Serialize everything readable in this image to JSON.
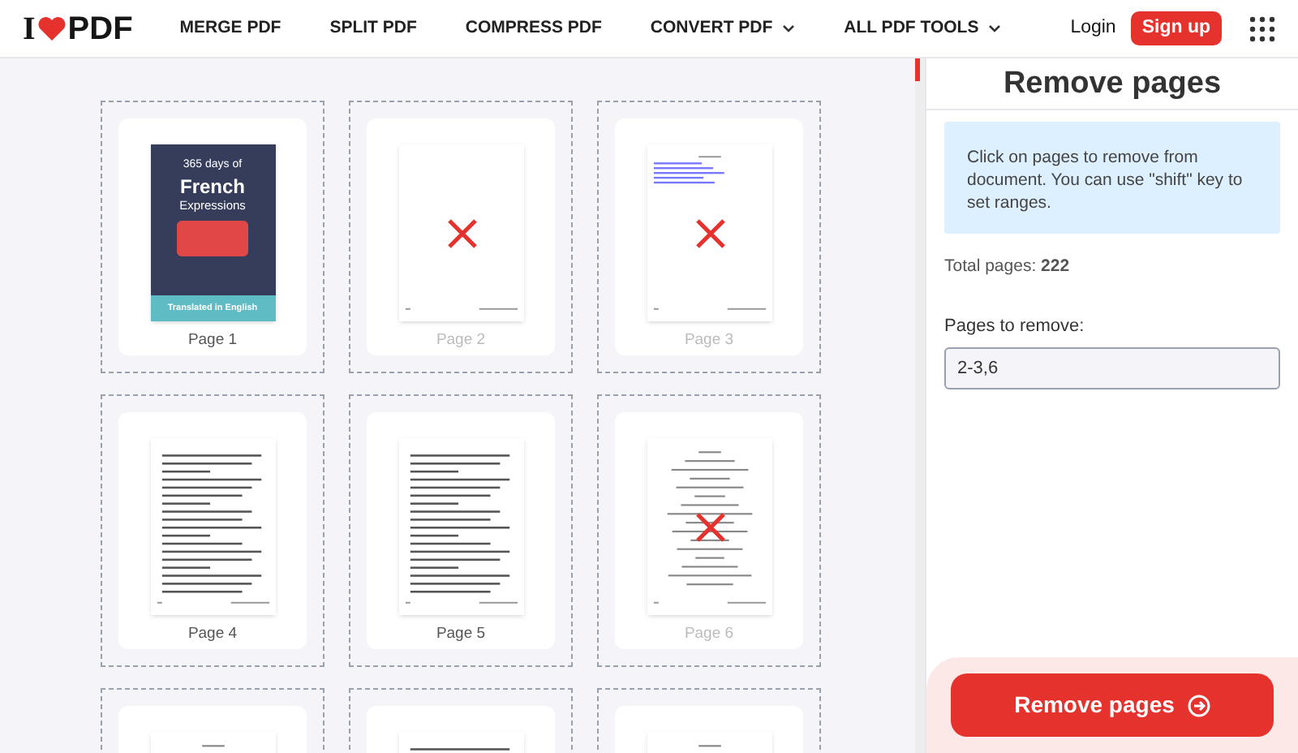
{
  "header": {
    "logo": {
      "left": "I",
      "right": "PDF"
    },
    "nav": [
      {
        "label": "MERGE PDF",
        "dropdown": false
      },
      {
        "label": "SPLIT PDF",
        "dropdown": false
      },
      {
        "label": "COMPRESS PDF",
        "dropdown": false
      },
      {
        "label": "CONVERT PDF",
        "dropdown": true
      },
      {
        "label": "ALL PDF TOOLS",
        "dropdown": true
      }
    ],
    "login": "Login",
    "signup": "Sign up"
  },
  "pages": [
    {
      "label": "Page 1",
      "removed": false,
      "kind": "cover",
      "cover": {
        "line1": "365 days of",
        "line2": "French",
        "line3": "Expressions",
        "band": "Translated in English"
      }
    },
    {
      "label": "Page 2",
      "removed": true,
      "kind": "blank"
    },
    {
      "label": "Page 3",
      "removed": true,
      "kind": "links"
    },
    {
      "label": "Page 4",
      "removed": false,
      "kind": "text"
    },
    {
      "label": "Page 5",
      "removed": false,
      "kind": "text"
    },
    {
      "label": "Page 6",
      "removed": true,
      "kind": "centered"
    },
    {
      "kind": "centered"
    },
    {
      "kind": "text"
    },
    {
      "kind": "centered"
    }
  ],
  "panel": {
    "title": "Remove pages",
    "info": "Click on pages to remove from document. You can use \"shift\" key to set ranges.",
    "total_label": "Total pages:",
    "total": "222",
    "field_label": "Pages to remove:",
    "field_value": "2-3,6",
    "button": "Remove pages"
  }
}
